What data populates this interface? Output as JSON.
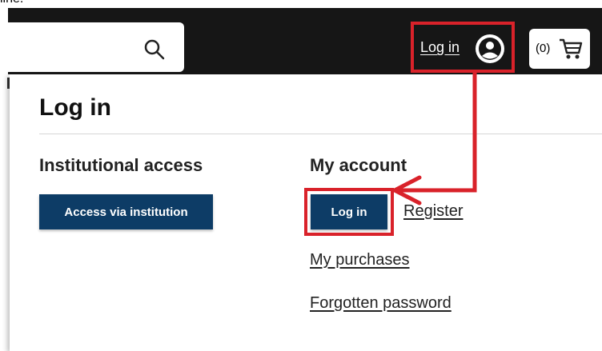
{
  "stray_text": "line.",
  "header": {
    "login_label": "Log in",
    "cart_count": "(0)",
    "icons": {
      "search": "search-icon",
      "user": "user-circle-icon",
      "cart": "cart-icon"
    }
  },
  "dropdown": {
    "title": "Log in",
    "institutional": {
      "heading": "Institutional access",
      "button_label": "Access via institution"
    },
    "account": {
      "heading": "My account",
      "login_button_label": "Log in",
      "register_label": "Register",
      "purchases_label": "My purchases",
      "forgot_label": "Forgotten password"
    }
  },
  "colors": {
    "topbar": "#161616",
    "primary_button": "#0d3c66",
    "annotation": "#d9222a"
  }
}
